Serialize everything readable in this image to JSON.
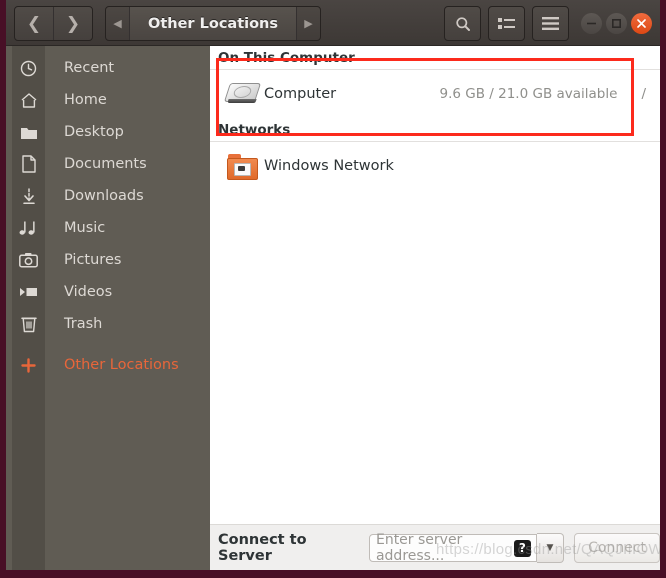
{
  "window": {
    "title": "Other Locations",
    "accent_color": "#dd4814",
    "titlebar_bg": "#413c39"
  },
  "headerbar": {
    "back_icon": "chevron-left-icon",
    "forward_icon": "chevron-right-icon",
    "path_prev_icon": "triangle-left-icon",
    "path_next_icon": "triangle-right-icon",
    "breadcrumb": "Other Locations",
    "search_icon": "search-icon",
    "view_toggle_icon": "list-view-icon",
    "menu_icon": "hamburger-menu-icon",
    "minimize_icon": "minimize-icon",
    "maximize_icon": "maximize-icon",
    "close_icon": "close-icon"
  },
  "sidebar": {
    "items": [
      {
        "label": "Recent",
        "icon": "clock-icon",
        "accent": false
      },
      {
        "label": "Home",
        "icon": "home-icon",
        "accent": false
      },
      {
        "label": "Desktop",
        "icon": "folder-icon",
        "accent": false
      },
      {
        "label": "Documents",
        "icon": "document-icon",
        "accent": false
      },
      {
        "label": "Downloads",
        "icon": "download-icon",
        "accent": false
      },
      {
        "label": "Music",
        "icon": "music-icon",
        "accent": false
      },
      {
        "label": "Pictures",
        "icon": "camera-icon",
        "accent": false
      },
      {
        "label": "Videos",
        "icon": "video-icon",
        "accent": false
      },
      {
        "label": "Trash",
        "icon": "trash-icon",
        "accent": false
      },
      {
        "label": "Other Locations",
        "icon": "plus-icon",
        "accent": true
      }
    ]
  },
  "main": {
    "group_on_this_computer": "On This Computer",
    "group_networks": "Networks",
    "computer": {
      "name": "Computer",
      "icon": "hard-disk-icon",
      "space": "9.6 GB / 21.0 GB available",
      "mount": "/"
    },
    "network": {
      "name": "Windows Network",
      "icon": "network-folder-icon"
    }
  },
  "connect_bar": {
    "label": "Connect to Server",
    "input_placeholder": "Enter server address...",
    "input_value": "",
    "help_icon": "help-icon",
    "dropdown_icon": "chevron-down-icon",
    "connect_label": "Connect"
  },
  "watermark": {
    "text": "https://blog.csdn.net/QAQJIIIOW"
  }
}
